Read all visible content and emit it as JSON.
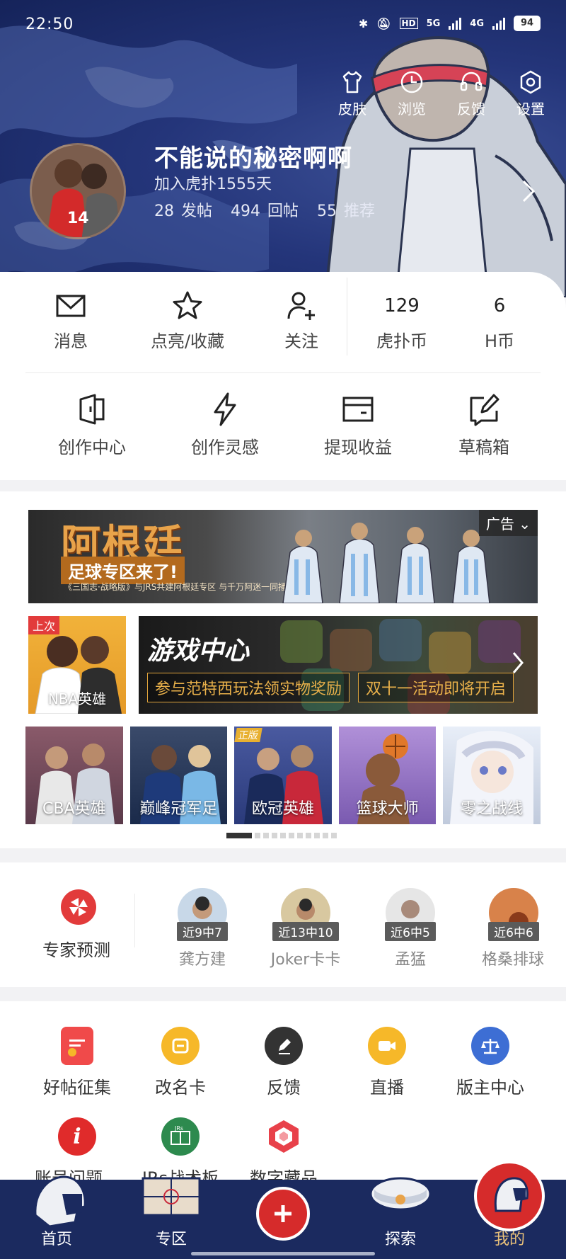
{
  "status_bar": {
    "time": "22:50",
    "network_1": "5G",
    "network_2": "4G",
    "battery": "94"
  },
  "top_nav": [
    {
      "label": "皮肤",
      "icon": "shirt-icon"
    },
    {
      "label": "浏览",
      "icon": "clock-icon"
    },
    {
      "label": "反馈",
      "icon": "headset-icon"
    },
    {
      "label": "设置",
      "icon": "settings-icon"
    }
  ],
  "profile": {
    "username": "不能说的秘密啊啊",
    "joined": "加入虎扑1555天",
    "posts_count": "28",
    "posts_label": "发帖",
    "replies_count": "494",
    "replies_label": "回帖",
    "recommend_count": "55",
    "recommend_label": "推荐",
    "avatar_number": "14"
  },
  "quick_row": {
    "messages": "消息",
    "likes": "点亮/收藏",
    "follow": "关注",
    "coin_value": "129",
    "coin_label": "虎扑币",
    "h_value": "6",
    "h_label": "H币"
  },
  "creator_row": [
    {
      "label": "创作中心",
      "icon": "creator-center-icon"
    },
    {
      "label": "创作灵感",
      "icon": "lightning-icon"
    },
    {
      "label": "提现收益",
      "icon": "wallet-icon"
    },
    {
      "label": "草稿箱",
      "icon": "draft-edit-icon"
    }
  ],
  "games": {
    "banner_title": "阿根廷",
    "banner_sub": "足球专区来了!",
    "banner_tiny": "《三国志·战略版》与JRS共建阿根廷专区 与千万阿迷一同播鼓助威!",
    "ad_label": "广告",
    "last_tag": "上次",
    "last_game": "NBA英雄",
    "center_title": "游戏中心",
    "pill_1": "参与范特西玩法领实物奖励",
    "pill_2": "双十一活动即将开启",
    "tiles": [
      "CBA英雄",
      "巅峰冠军足",
      "欧冠英雄",
      "篮球大师",
      "零之战线"
    ],
    "tile_badge": "正版"
  },
  "experts": {
    "label": "专家预测",
    "list": [
      {
        "badge": "近9中7",
        "name": "龚方建"
      },
      {
        "badge": "近13中10",
        "name": "Joker卡卡"
      },
      {
        "badge": "近6中5",
        "name": "孟猛"
      },
      {
        "badge": "近6中6",
        "name": "格桑排球"
      }
    ]
  },
  "tools": [
    {
      "label": "好帖征集",
      "color": "#f04a4a"
    },
    {
      "label": "改名卡",
      "color": "#f6b829"
    },
    {
      "label": "反馈",
      "color": "#333333"
    },
    {
      "label": "直播",
      "color": "#f6b829"
    },
    {
      "label": "版主中心",
      "color": "#3d6ed4"
    },
    {
      "label": "账号问题…",
      "color": "#e02b2b"
    },
    {
      "label": "JRs战术板",
      "color": "#2d8a4e"
    },
    {
      "label": "数字藏品",
      "color": "#e8414a"
    }
  ],
  "bottom_nav": [
    {
      "label": "首页"
    },
    {
      "label": "专区"
    },
    {
      "label": "探索"
    },
    {
      "label": "我的"
    }
  ]
}
